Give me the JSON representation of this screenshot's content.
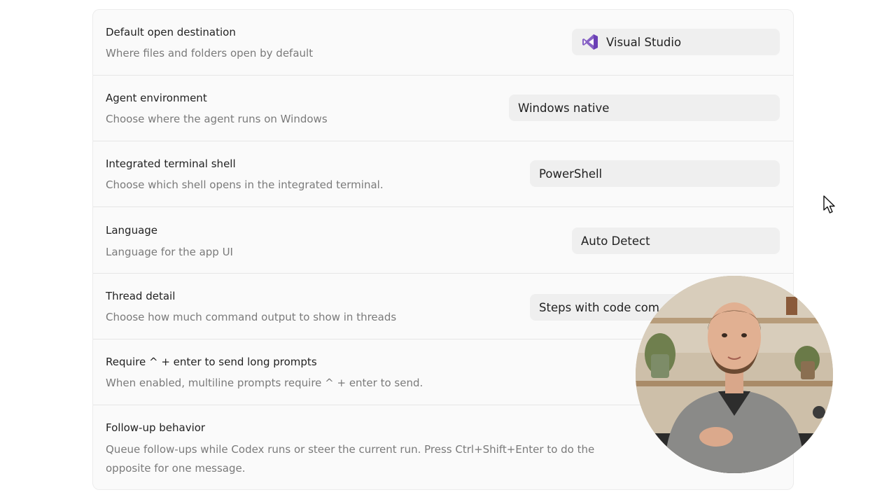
{
  "settings": {
    "rows": [
      {
        "title": "Default open destination",
        "description": "Where files and folders open by default",
        "value": "Visual Studio",
        "icon": "visual-studio-icon"
      },
      {
        "title": "Agent environment",
        "description": "Choose where the agent runs on Windows",
        "value": "Windows native"
      },
      {
        "title": "Integrated terminal shell",
        "description": "Choose which shell opens in the integrated terminal.",
        "value": "PowerShell"
      },
      {
        "title": "Language",
        "description": "Language for the app UI",
        "value": "Auto Detect"
      },
      {
        "title": "Thread detail",
        "description": "Choose how much command output to show in threads",
        "value": "Steps with code com"
      },
      {
        "title": "Require ^ + enter to send long prompts",
        "description": "When enabled, multiline prompts require ^ + enter to send."
      },
      {
        "title": "Follow-up behavior",
        "description": "Queue follow-ups while Codex runs or steer the current run. Press Ctrl+Shift+Enter to do the opposite for one message."
      }
    ]
  },
  "colors": {
    "panel_bg": "#fafafa",
    "select_bg": "#efefef",
    "title_text": "#222222",
    "description_text": "#7a7a7a",
    "visual_studio_purple": "#7b4fc9"
  },
  "overlay": {
    "webcam_icon": "presenter-webcam",
    "cursor_icon": "mouse-pointer-icon"
  }
}
